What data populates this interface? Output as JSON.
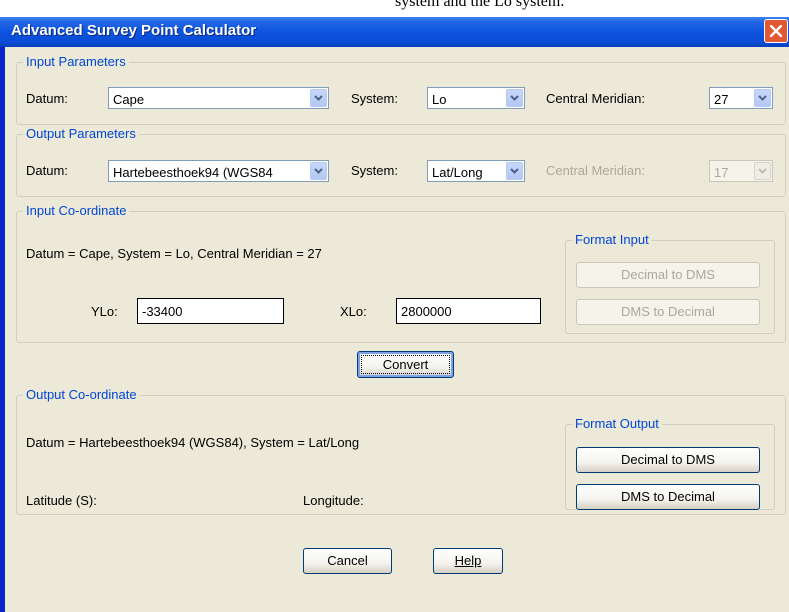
{
  "background_text": "system and the Lo system.",
  "window": {
    "title": "Advanced Survey Point Calculator",
    "close_icon": "close-x-icon"
  },
  "input_params": {
    "legend": "Input Parameters",
    "datum_label": "Datum:",
    "datum_value": "Cape",
    "system_label": "System:",
    "system_value": "Lo",
    "cm_label": "Central Meridian:",
    "cm_value": "27"
  },
  "output_params": {
    "legend": "Output Parameters",
    "datum_label": "Datum:",
    "datum_value": "Hartebeesthoek94 (WGS84",
    "system_label": "System:",
    "system_value": "Lat/Long",
    "cm_label": "Central Meridian:",
    "cm_value": "17"
  },
  "input_coord": {
    "legend": "Input Co-ordinate",
    "summary": "Datum = Cape, System = Lo, Central Meridian = 27",
    "y_label": "YLo:",
    "y_value": "-33400",
    "x_label": "XLo:",
    "x_value": "2800000",
    "format": {
      "legend": "Format Input",
      "dec_to_dms": "Decimal to DMS",
      "dms_to_dec": "DMS to Decimal"
    }
  },
  "convert_label": "Convert",
  "output_coord": {
    "legend": "Output Co-ordinate",
    "summary": "Datum = Hartebeesthoek94 (WGS84), System = Lat/Long",
    "lat_label": "Latitude (S):",
    "lon_label": "Longitude:",
    "format": {
      "legend": "Format Output",
      "dec_to_dms": "Decimal to DMS",
      "dms_to_dec": "DMS to Decimal"
    }
  },
  "cancel_label": "Cancel",
  "help_label": "Help",
  "colors": {
    "title_bar": "#0b54e0",
    "legend_text": "#0046d5",
    "dialog_bg": "#ece9d8",
    "close_button": "#e25a34"
  }
}
